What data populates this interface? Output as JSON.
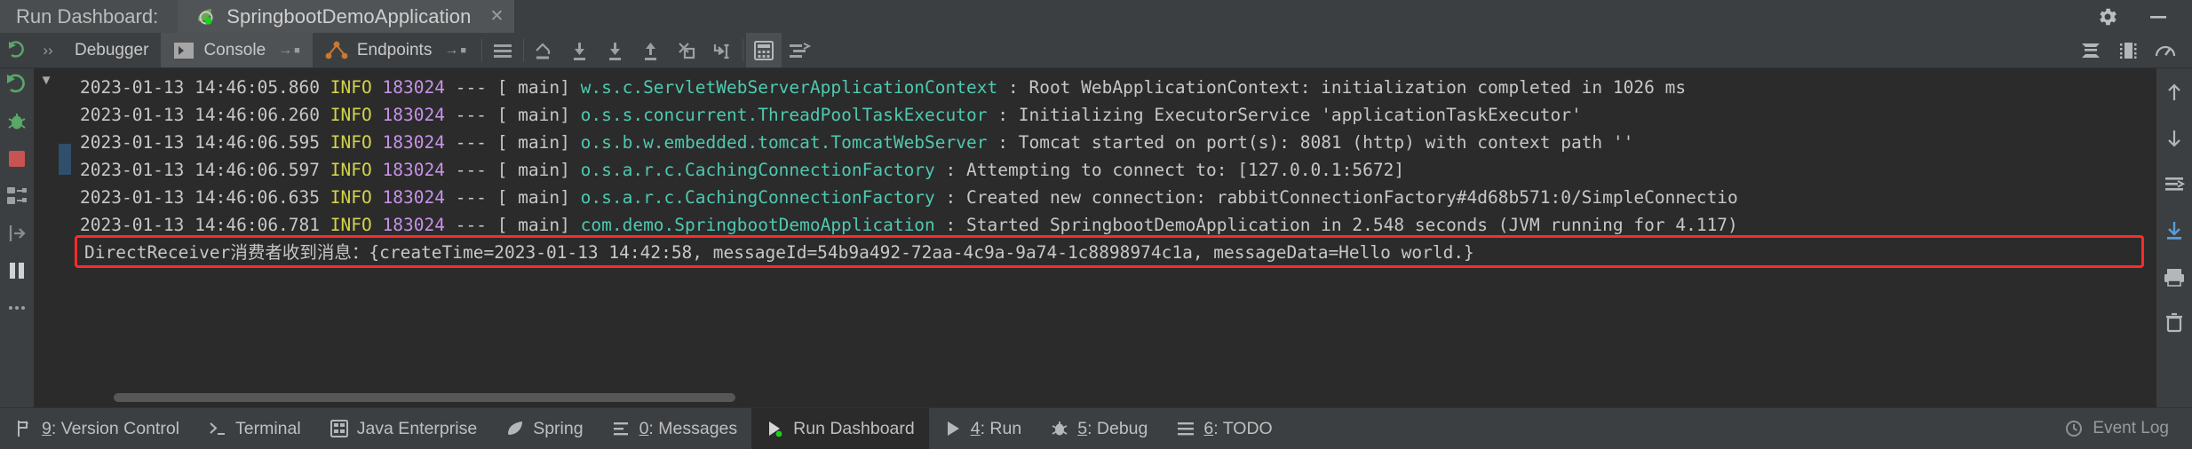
{
  "titlebar": {
    "run_dashboard_label": "Run Dashboard:",
    "tab_title": "SpringbootDemoApplication",
    "close_glyph": "✕",
    "settings_icon": "gear-icon",
    "minimize_icon": "minimize-icon"
  },
  "toolbar": {
    "expand_glyph": "››",
    "tabs": [
      {
        "label": "Debugger",
        "selected": false,
        "detach_glyph": ""
      },
      {
        "label": "Console",
        "selected": true,
        "detach_glyph": "→"
      },
      {
        "label": "Endpoints",
        "selected": false,
        "detach_glyph": "→"
      }
    ],
    "icons": [
      "menu-lines-icon",
      "step-over-icon",
      "step-into-icon",
      "force-step-into-icon",
      "step-out-icon",
      "drop-frame-icon",
      "run-to-cursor-icon",
      "evaluate-expression-icon",
      "settings-threads-icon"
    ],
    "right_icons": [
      "soft-wrap-icon",
      "print-icon",
      "profiler-icon"
    ]
  },
  "left_rail": {
    "icons": [
      "rerun-icon",
      "debug-bug-icon",
      "stop-icon",
      "layout-icon",
      "resume-icon",
      "pause-icon",
      "more-icon"
    ]
  },
  "right_rail": {
    "icons": [
      "scroll-up-icon",
      "scroll-down-icon",
      "soft-wrap-toggle-icon",
      "scroll-to-end-icon",
      "print-icon",
      "clear-all-icon"
    ]
  },
  "console": {
    "fold_glyph": "▼",
    "lines": [
      {
        "date": "2023-01-13 14:46:05.860",
        "level": "INFO",
        "pid": "183024",
        "sep": "---",
        "thread": "[           main]",
        "logger": "w.s.c.ServletWebServerApplicationContext",
        "logger_pad": "",
        "message": ": Root WebApplicationContext: initialization completed in 1026 ms"
      },
      {
        "date": "2023-01-13 14:46:06.260",
        "level": "INFO",
        "pid": "183024",
        "sep": "---",
        "thread": "[           main]",
        "logger": "o.s.s.concurrent.ThreadPoolTaskExecutor",
        "logger_pad": "  ",
        "message": ": Initializing ExecutorService 'applicationTaskExecutor'"
      },
      {
        "date": "2023-01-13 14:46:06.595",
        "level": "INFO",
        "pid": "183024",
        "sep": "---",
        "thread": "[           main]",
        "logger": "o.s.b.w.embedded.tomcat.TomcatWebServer",
        "logger_pad": "  ",
        "message": ": Tomcat started on port(s): 8081 (http) with context path ''"
      },
      {
        "date": "2023-01-13 14:46:06.597",
        "level": "INFO",
        "pid": "183024",
        "sep": "---",
        "thread": "[           main]",
        "logger": "o.s.a.r.c.CachingConnectionFactory",
        "logger_pad": "       ",
        "message": ": Attempting to connect to: [127.0.0.1:5672]"
      },
      {
        "date": "2023-01-13 14:46:06.635",
        "level": "INFO",
        "pid": "183024",
        "sep": "---",
        "thread": "[           main]",
        "logger": "o.s.a.r.c.CachingConnectionFactory",
        "logger_pad": "       ",
        "message": ": Created new connection: rabbitConnectionFactory#4d68b571:0/SimpleConnectio"
      },
      {
        "date": "2023-01-13 14:46:06.781",
        "level": "INFO",
        "pid": "183024",
        "sep": "---",
        "thread": "[           main]",
        "logger": "com.demo.SpringbootDemoApplication",
        "logger_pad": "      ",
        "message": ": Started SpringbootDemoApplication in 2.548 seconds (JVM running for 4.117)"
      }
    ],
    "highlighted_line": "DirectReceiver消费者收到消息：{createTime=2023-01-13 14:42:58, messageId=54b9a492-72aa-4c9a-9a74-1c8898974c1a, messageData=Hello world.}",
    "highlight_color": "#ff2a2a"
  },
  "statusbar": {
    "items": [
      {
        "shortcut": "9",
        "label": ": Version Control",
        "icon": "version-control-icon",
        "active": false
      },
      {
        "shortcut": "",
        "label": "Terminal",
        "icon": "terminal-icon",
        "active": false
      },
      {
        "shortcut": "",
        "label": "Java Enterprise",
        "icon": "java-enterprise-icon",
        "active": false
      },
      {
        "shortcut": "",
        "label": "Spring",
        "icon": "spring-leaf-icon",
        "active": false
      },
      {
        "shortcut": "0",
        "label": ": Messages",
        "icon": "messages-icon",
        "active": false
      },
      {
        "shortcut": "",
        "label": "Run Dashboard",
        "icon": "run-dashboard-icon",
        "active": true
      },
      {
        "shortcut": "4",
        "label": ": Run",
        "icon": "run-icon",
        "active": false
      },
      {
        "shortcut": "5",
        "label": ": Debug",
        "icon": "debug-icon",
        "active": false
      },
      {
        "shortcut": "6",
        "label": ": TODO",
        "icon": "todo-icon",
        "active": false
      }
    ],
    "event_log_label": "Event Log",
    "event_log_icon": "event-log-icon"
  }
}
